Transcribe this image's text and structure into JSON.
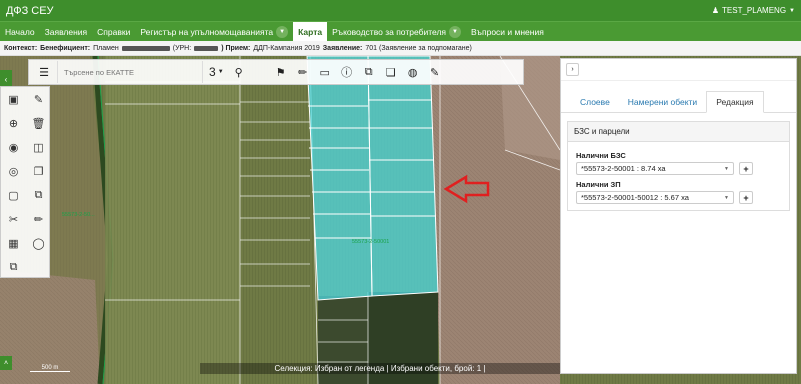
{
  "app": {
    "title": "ДФЗ СЕУ",
    "user": "TEST_PLAMENG"
  },
  "nav": {
    "items": [
      {
        "label": "Начало"
      },
      {
        "label": "Заявления"
      },
      {
        "label": "Справки"
      },
      {
        "label": "Регистър на упълномощаванията"
      },
      {
        "label": "Карта"
      },
      {
        "label": "Ръководство за потребителя"
      },
      {
        "label": "Въпроси и мнения"
      }
    ]
  },
  "context": {
    "label_context": "Контекст:",
    "label_beneficiary": "Бенефициент:",
    "beneficiary": "Пламен",
    "urn_label": "(УРН:",
    "reception_label": ") Прием:",
    "reception": "ДДП-Кампания 2019",
    "application_label": "Заявление:",
    "application": "701 (Заявление за подпомагане)"
  },
  "toolbar": {
    "search_placeholder": "Търсене по ЕКАТТЕ",
    "zoom_value": "3"
  },
  "map": {
    "parcel_label_1": "55573-2-50001",
    "parcel_label_2": "55573-2-50...",
    "scale_label": "500 m",
    "status_text": "Селекция: Избран от легенда  |  Избрани обекти, брой: 1  |"
  },
  "panel": {
    "tabs": [
      {
        "label": "Слоеве"
      },
      {
        "label": "Намерени обекти"
      },
      {
        "label": "Редакция"
      }
    ],
    "section_title": "БЗС и парцели",
    "bzs_label": "Налични БЗС",
    "bzs_value": "*55573-2-50001 : 8.74 ха",
    "zp_label": "Налични ЗП",
    "zp_value": "*55573-2-50001-50012 : 5.67 ха"
  },
  "colors": {
    "brand": "#3e8e2c",
    "selection": "#4fd8e0",
    "arrow": "#e02020"
  }
}
